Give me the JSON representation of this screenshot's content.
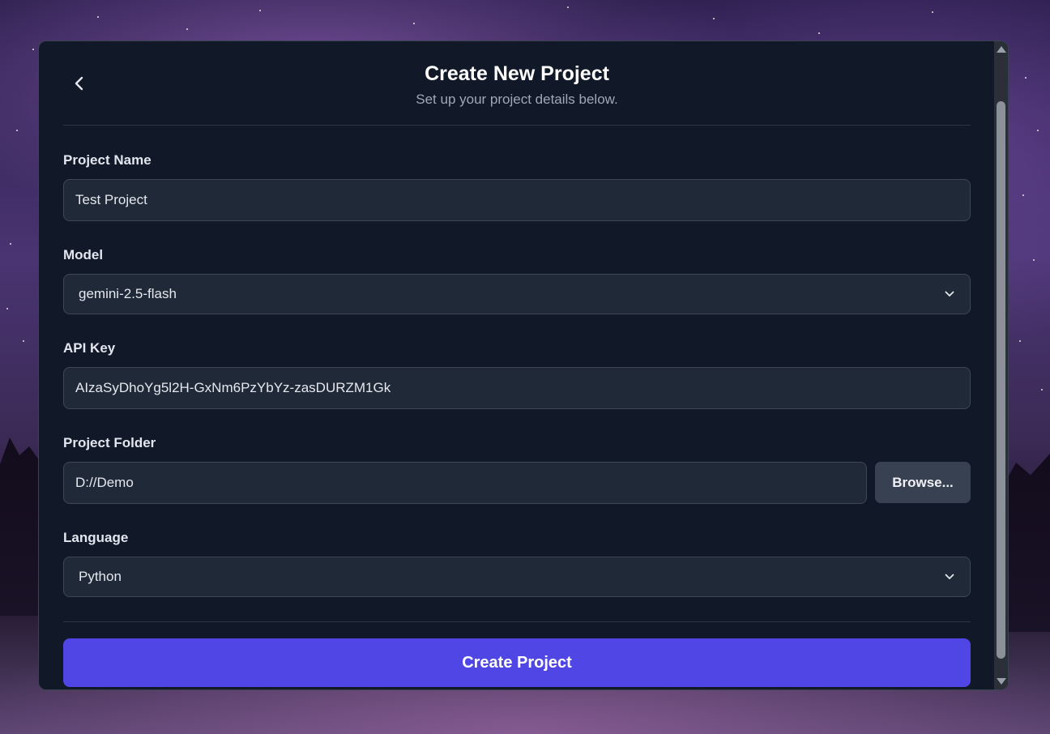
{
  "header": {
    "title": "Create New Project",
    "subtitle": "Set up your project details below.",
    "back_icon": "chevron-left-icon"
  },
  "form": {
    "project_name": {
      "label": "Project Name",
      "value": "Test Project"
    },
    "model": {
      "label": "Model",
      "value": "gemini-2.5-flash"
    },
    "api_key": {
      "label": "API Key",
      "value": "AIzaSyDhoYg5l2H-GxNm6PzYbYz-zasDURZM1Gk"
    },
    "project_folder": {
      "label": "Project Folder",
      "value": "D://Demo",
      "browse_label": "Browse..."
    },
    "language": {
      "label": "Language",
      "value": "Python"
    }
  },
  "actions": {
    "create_label": "Create Project"
  },
  "colors": {
    "panel_bg": "#111827",
    "input_bg": "#1f2937",
    "accent": "#4f46e5",
    "secondary_button": "#374151"
  }
}
